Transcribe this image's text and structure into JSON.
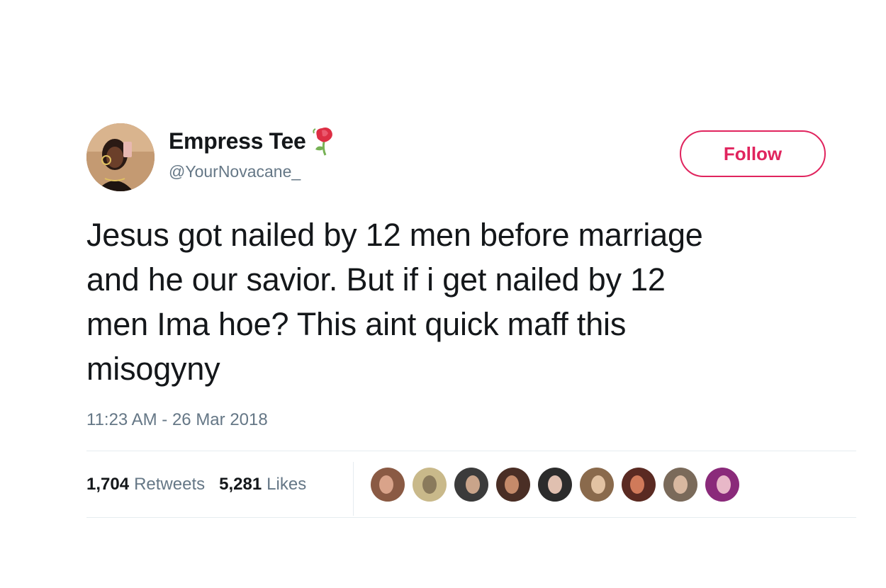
{
  "tweet": {
    "author": {
      "display_name": "Empress Tee",
      "handle": "@YourNovacane_",
      "name_emoji": "rose-icon"
    },
    "follow_label": "Follow",
    "text": "Jesus got nailed by 12 men before marriage\nand he our savior. But if i get nailed by 12\nmen Ima hoe? This aint quick maff this\nmisogyny",
    "timestamp": "11:23 AM - 26 Mar 2018",
    "stats": {
      "retweets_count": "1,704",
      "retweets_label": "Retweets",
      "likes_count": "5,281",
      "likes_label": "Likes"
    },
    "liker_avatars": [
      {
        "name": "liker-avatar-1",
        "colors": [
          "#8a5a44",
          "#d9a38a"
        ]
      },
      {
        "name": "liker-avatar-2",
        "colors": [
          "#c9b98a",
          "#8a7a5c"
        ]
      },
      {
        "name": "liker-avatar-3",
        "colors": [
          "#3b3b3b",
          "#c9a48a"
        ]
      },
      {
        "name": "liker-avatar-4",
        "colors": [
          "#4a2e25",
          "#c58a6a"
        ]
      },
      {
        "name": "liker-avatar-5",
        "colors": [
          "#2c2c2c",
          "#e0c0b0"
        ]
      },
      {
        "name": "liker-avatar-6",
        "colors": [
          "#8a6a4c",
          "#e2c2a2"
        ]
      },
      {
        "name": "liker-avatar-7",
        "colors": [
          "#5a2a22",
          "#d07a5a"
        ]
      },
      {
        "name": "liker-avatar-8",
        "colors": [
          "#7a6a5a",
          "#d8b8a0"
        ]
      },
      {
        "name": "liker-avatar-9",
        "colors": [
          "#8a2a7a",
          "#e8b8c8"
        ]
      }
    ]
  },
  "colors": {
    "follow_accent": "#e0245e",
    "text_primary": "#14171a",
    "text_secondary": "#657786",
    "divider": "#e6ecf0"
  }
}
